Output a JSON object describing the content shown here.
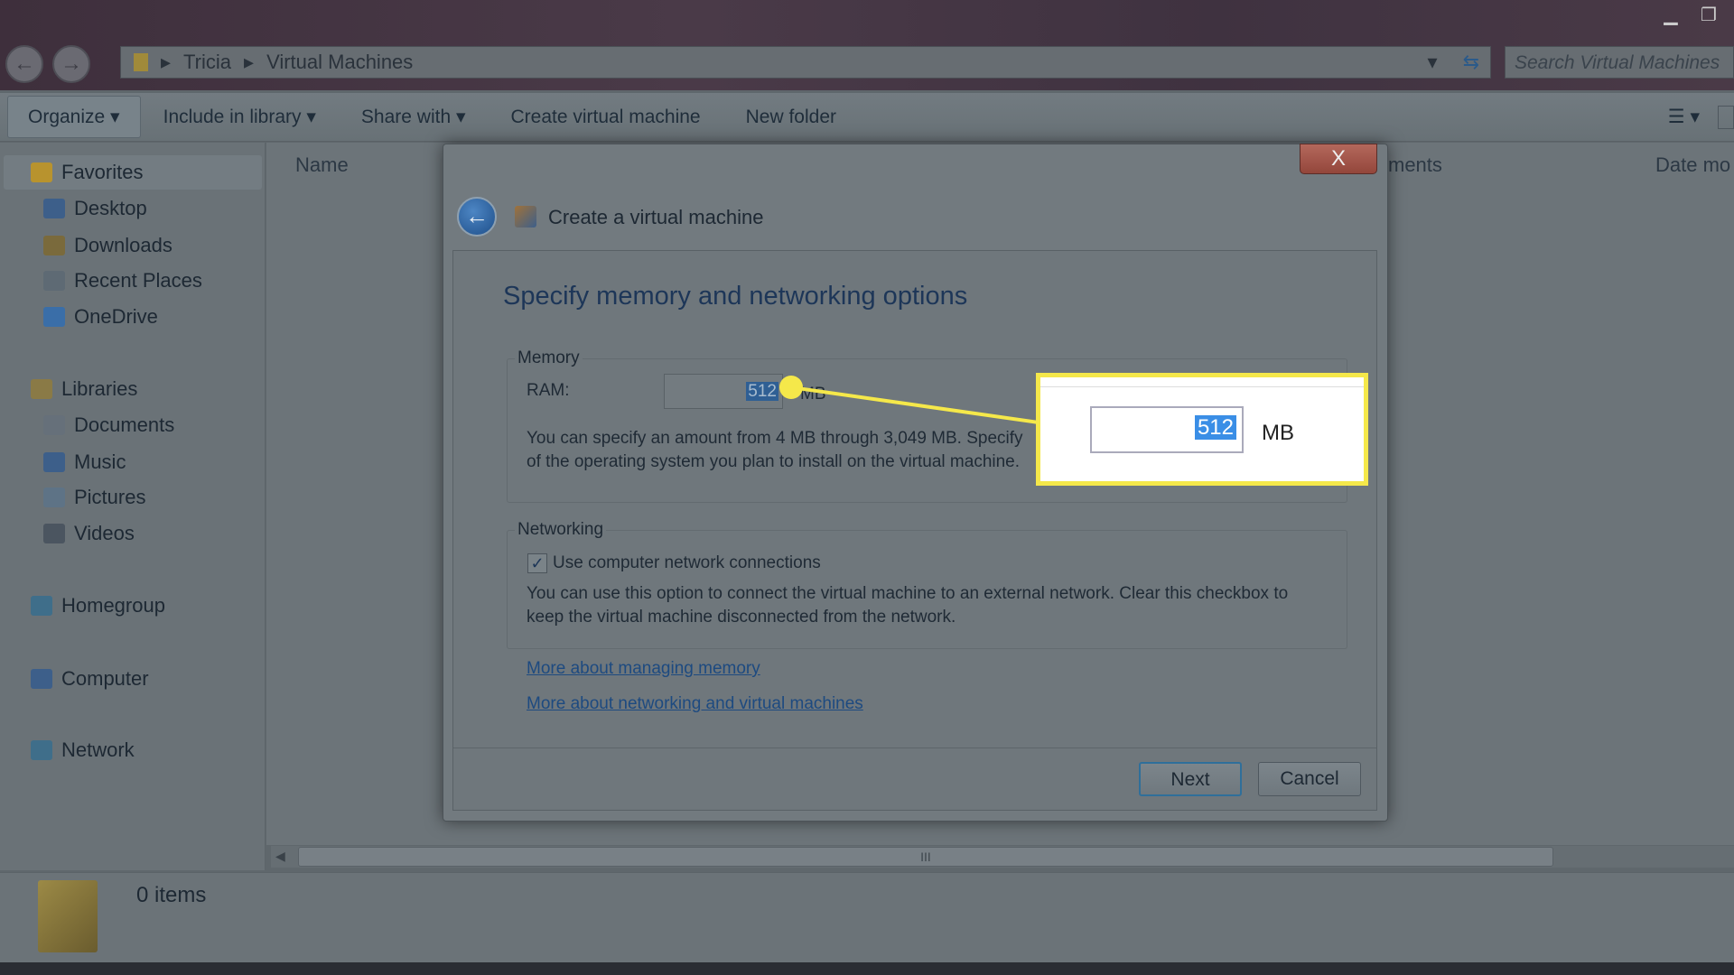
{
  "window": {
    "breadcrumb": [
      "Tricia",
      "Virtual Machines"
    ],
    "search_placeholder": "Search Virtual Machines"
  },
  "toolbar": {
    "organize": "Organize",
    "include": "Include in library",
    "share": "Share with",
    "create_vm": "Create virtual machine",
    "new_folder": "New folder"
  },
  "sidebar": {
    "items": [
      {
        "label": "Favorites",
        "icon": "star-icon",
        "color": "#b8932e"
      },
      {
        "label": "Desktop",
        "icon": "desktop-icon",
        "color": "#3d5f8a"
      },
      {
        "label": "Downloads",
        "icon": "downloads-icon",
        "color": "#7a6a3c"
      },
      {
        "label": "Recent Places",
        "icon": "recent-places-icon",
        "color": "#5e6a74"
      },
      {
        "label": "OneDrive",
        "icon": "cloud-icon",
        "color": "#3a6ea8"
      },
      {
        "label": "Libraries",
        "icon": "libraries-icon",
        "color": "#8a7a46"
      },
      {
        "label": "Documents",
        "icon": "documents-icon",
        "color": "#66707a"
      },
      {
        "label": "Music",
        "icon": "music-icon",
        "color": "#3d5f8a"
      },
      {
        "label": "Pictures",
        "icon": "pictures-icon",
        "color": "#5e7386"
      },
      {
        "label": "Videos",
        "icon": "videos-icon",
        "color": "#4b5560"
      },
      {
        "label": "Homegroup",
        "icon": "homegroup-icon",
        "color": "#3f6e8a"
      },
      {
        "label": "Computer",
        "icon": "computer-icon",
        "color": "#3d5f8a"
      },
      {
        "label": "Network",
        "icon": "network-icon",
        "color": "#3f6e8a"
      }
    ]
  },
  "columns": {
    "name": "Name",
    "attachments": "ments",
    "date": "Date mo"
  },
  "status": {
    "items": "0 items"
  },
  "dialog": {
    "title": "Create a virtual machine",
    "close": "X",
    "heading": "Specify memory and networking options",
    "memory": {
      "label": "Memory",
      "ram_label": "RAM:",
      "ram_value": "512",
      "unit": "MB",
      "desc1": "You can specify an amount from 4 MB through 3,049 MB. Specify",
      "desc2": "of the operating system you plan to install on the virtual machine."
    },
    "networking": {
      "label": "Networking",
      "checkbox_label": "Use computer network connections",
      "checked": true,
      "desc1": "You can use this option to connect the virtual machine to an external network. Clear this checkbox to",
      "desc2": "keep the virtual machine disconnected from the network."
    },
    "links": [
      "More about managing memory",
      "More about networking and virtual machines"
    ],
    "next": "Next",
    "cancel": "Cancel"
  },
  "callout": {
    "value": "512",
    "unit": "MB",
    "highlight_color": "#f5e84a",
    "selection_color": "#3a8ee6"
  }
}
